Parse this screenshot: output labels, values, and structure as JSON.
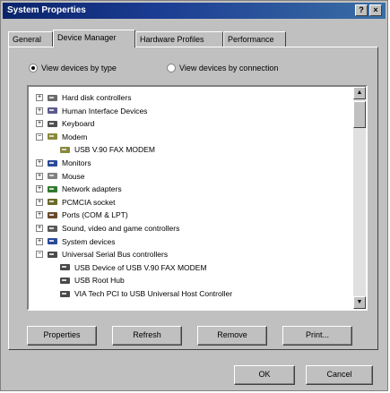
{
  "window": {
    "title": "System Properties",
    "help_label": "?",
    "close_label": "×"
  },
  "tabs": [
    {
      "label": "General"
    },
    {
      "label": "Device Manager"
    },
    {
      "label": "Hardware Profiles"
    },
    {
      "label": "Performance"
    }
  ],
  "view_options": {
    "by_type": "View devices by type",
    "by_connection": "View devices by connection",
    "selected": "by_type"
  },
  "tree": [
    {
      "label": "Hard disk controllers",
      "icon": "disk-controller-icon",
      "expander": "+"
    },
    {
      "label": "Human Interface Devices",
      "icon": "hid-icon",
      "expander": "+"
    },
    {
      "label": "Keyboard",
      "icon": "keyboard-icon",
      "expander": "+"
    },
    {
      "label": "Modem",
      "icon": "modem-icon",
      "expander": "−"
    },
    {
      "label": "USB V.90 FAX MODEM",
      "icon": "modem-icon",
      "expander": ""
    },
    {
      "label": "Monitors",
      "icon": "monitor-icon",
      "expander": "+"
    },
    {
      "label": "Mouse",
      "icon": "mouse-icon",
      "expander": "+"
    },
    {
      "label": "Network adapters",
      "icon": "network-adapter-icon",
      "expander": "+"
    },
    {
      "label": "PCMCIA socket",
      "icon": "pcmcia-icon",
      "expander": "+"
    },
    {
      "label": "Ports (COM & LPT)",
      "icon": "port-icon",
      "expander": "+"
    },
    {
      "label": "Sound, video and game controllers",
      "icon": "sound-icon",
      "expander": "+"
    },
    {
      "label": "System devices",
      "icon": "system-device-icon",
      "expander": "+"
    },
    {
      "label": "Universal Serial Bus controllers",
      "icon": "usb-icon",
      "expander": "−"
    },
    {
      "label": "USB Device of USB V.90 FAX MODEM",
      "icon": "usb-icon",
      "expander": ""
    },
    {
      "label": "USB Root Hub",
      "icon": "usb-icon",
      "expander": ""
    },
    {
      "label": "VIA Tech PCI to USB Universal Host Controller",
      "icon": "usb-icon",
      "expander": ""
    }
  ],
  "buttons": {
    "properties": "Properties",
    "refresh": "Refresh",
    "remove": "Remove",
    "print": "Print...",
    "ok": "OK",
    "cancel": "Cancel"
  }
}
